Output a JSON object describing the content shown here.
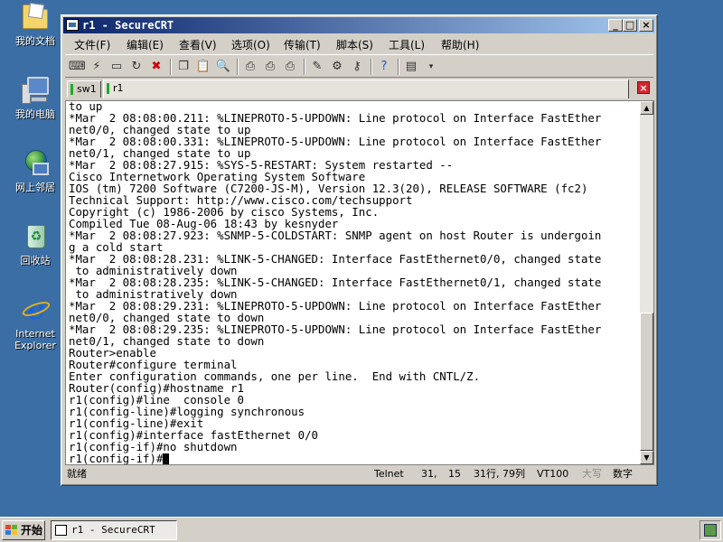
{
  "desktop": {
    "icons": [
      {
        "label": "我的文档",
        "icon": "my-documents-icon"
      },
      {
        "label": "我的电脑",
        "icon": "my-computer-icon"
      },
      {
        "label": "网上邻居",
        "icon": "network-neighborhood-icon"
      },
      {
        "label": "回收站",
        "icon": "recycle-bin-icon"
      },
      {
        "label": "Internet Explorer",
        "icon": "internet-explorer-icon"
      }
    ]
  },
  "window": {
    "title": "r1 - SecureCRT",
    "controls": {
      "minimize": "_",
      "maximize": "□",
      "close": "×"
    }
  },
  "menu": [
    {
      "label": "文件(F)"
    },
    {
      "label": "编辑(E)"
    },
    {
      "label": "查看(V)"
    },
    {
      "label": "选项(O)"
    },
    {
      "label": "传输(T)"
    },
    {
      "label": "脚本(S)"
    },
    {
      "label": "工具(L)"
    },
    {
      "label": "帮助(H)"
    }
  ],
  "toolbar": {
    "icons": [
      "connect-icon",
      "quick-connect-icon",
      "connect-tab-icon",
      "reconnect-icon",
      "disconnect-icon",
      "copy-icon",
      "paste-icon",
      "find-icon",
      "print-icon",
      "print-selection-icon",
      "print-setup-icon",
      "session-options-icon",
      "global-options-icon",
      "keymap-icon",
      "help-icon",
      "log-icon",
      "more-icon"
    ]
  },
  "tabs": [
    {
      "label": "sw1",
      "active": false
    },
    {
      "label": "r1",
      "active": true
    }
  ],
  "terminal": {
    "lines": [
      "to up",
      "*Mar  2 08:08:00.211: %LINEPROTO-5-UPDOWN: Line protocol on Interface FastEther",
      "net0/0, changed state to up",
      "*Mar  2 08:08:00.331: %LINEPROTO-5-UPDOWN: Line protocol on Interface FastEther",
      "net0/1, changed state to up",
      "*Mar  2 08:08:27.915: %SYS-5-RESTART: System restarted --",
      "Cisco Internetwork Operating System Software",
      "IOS (tm) 7200 Software (C7200-JS-M), Version 12.3(20), RELEASE SOFTWARE (fc2)",
      "Technical Support: http://www.cisco.com/techsupport",
      "Copyright (c) 1986-2006 by cisco Systems, Inc.",
      "Compiled Tue 08-Aug-06 18:43 by kesnyder",
      "*Mar  2 08:08:27.923: %SNMP-5-COLDSTART: SNMP agent on host Router is undergoin",
      "g a cold start",
      "*Mar  2 08:08:28.231: %LINK-5-CHANGED: Interface FastEthernet0/0, changed state",
      " to administratively down",
      "*Mar  2 08:08:28.235: %LINK-5-CHANGED: Interface FastEthernet0/1, changed state",
      " to administratively down",
      "*Mar  2 08:08:29.231: %LINEPROTO-5-UPDOWN: Line protocol on Interface FastEther",
      "net0/0, changed state to down",
      "*Mar  2 08:08:29.235: %LINEPROTO-5-UPDOWN: Line protocol on Interface FastEther",
      "net0/1, changed state to down",
      "Router>enable",
      "Router#configure terminal",
      "Enter configuration commands, one per line.  End with CNTL/Z.",
      "Router(config)#hostname r1",
      "r1(config)#line  console 0",
      "r1(config-line)#logging synchronous",
      "r1(config-line)#exit",
      "r1(config)#interface fastEthernet 0/0",
      "r1(config-if)#no shutdown",
      "r1(config-if)#"
    ]
  },
  "statusbar": {
    "ready": "就绪",
    "protocol": "Telnet",
    "row": "31,",
    "col": "15",
    "size": "31行, 79列",
    "emulation": "VT100",
    "caps": "大写",
    "num": "数字"
  },
  "taskbar": {
    "start_label": "开始",
    "task_label": "r1 - SecureCRT"
  },
  "colors": {
    "desktop": "#3a6ea5",
    "titlebar_start": "#0a246a",
    "titlebar_end": "#a6caf0",
    "tab_indicator": "#1ea82a",
    "tab_close": "#d6262f"
  }
}
